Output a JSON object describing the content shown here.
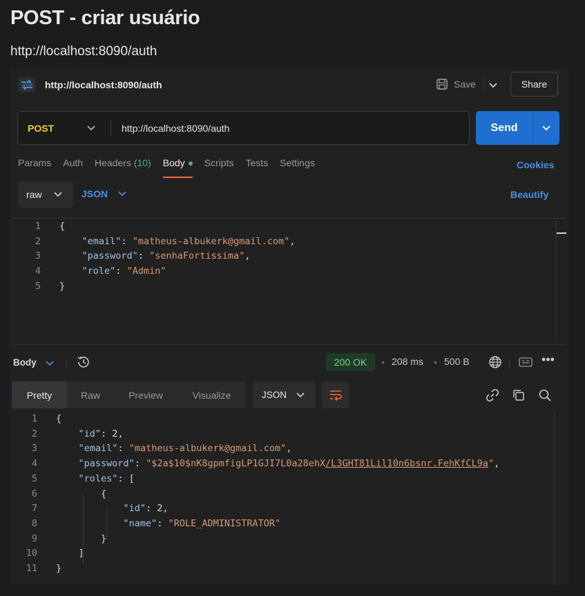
{
  "doc": {
    "title": "POST - criar usuário",
    "url": "http://localhost:8090/auth"
  },
  "request": {
    "name": "http://localhost:8090/auth",
    "badge": "HTTP",
    "save_label": "Save",
    "share_label": "Share",
    "method": "POST",
    "url": "http://localhost:8090/auth",
    "send_label": "Send",
    "tabs": [
      {
        "label": "Params"
      },
      {
        "label": "Auth"
      },
      {
        "label": "Headers",
        "count": "(10)"
      },
      {
        "label": "Body",
        "active": true
      },
      {
        "label": "Scripts"
      },
      {
        "label": "Tests"
      },
      {
        "label": "Settings"
      }
    ],
    "cookies_label": "Cookies",
    "body_mode": "raw",
    "body_format": "JSON",
    "beautify_label": "Beautify",
    "body_lines": [
      {
        "n": "1",
        "parts": [
          {
            "t": "{",
            "c": "p"
          }
        ]
      },
      {
        "n": "2",
        "parts": [
          {
            "t": "    ",
            "c": "p"
          },
          {
            "t": "\"email\"",
            "c": "k"
          },
          {
            "t": ": ",
            "c": "p"
          },
          {
            "t": "\"matheus-albukerk@gmail.com\"",
            "c": "s"
          },
          {
            "t": ",",
            "c": "p"
          }
        ]
      },
      {
        "n": "3",
        "parts": [
          {
            "t": "    ",
            "c": "p"
          },
          {
            "t": "\"password\"",
            "c": "k"
          },
          {
            "t": ": ",
            "c": "p"
          },
          {
            "t": "\"senhaFortissima\"",
            "c": "s"
          },
          {
            "t": ",",
            "c": "p"
          }
        ]
      },
      {
        "n": "4",
        "parts": [
          {
            "t": "    ",
            "c": "p"
          },
          {
            "t": "\"role\"",
            "c": "k"
          },
          {
            "t": ": ",
            "c": "p"
          },
          {
            "t": "\"Admin\"",
            "c": "s"
          }
        ]
      },
      {
        "n": "5",
        "parts": [
          {
            "t": "}",
            "c": "p"
          }
        ]
      }
    ]
  },
  "response": {
    "section_label": "Body",
    "status": "200 OK",
    "time": "208 ms",
    "size": "500 B",
    "tabs": [
      {
        "label": "Pretty",
        "active": true
      },
      {
        "label": "Raw"
      },
      {
        "label": "Preview"
      },
      {
        "label": "Visualize"
      }
    ],
    "format": "JSON",
    "body_lines": [
      {
        "n": "1",
        "parts": [
          {
            "t": "{",
            "c": "p"
          }
        ]
      },
      {
        "n": "2",
        "parts": [
          {
            "t": "    ",
            "c": "p"
          },
          {
            "t": "\"id\"",
            "c": "k"
          },
          {
            "t": ": ",
            "c": "p"
          },
          {
            "t": "2",
            "c": "n"
          },
          {
            "t": ",",
            "c": "p"
          }
        ]
      },
      {
        "n": "3",
        "parts": [
          {
            "t": "    ",
            "c": "p"
          },
          {
            "t": "\"email\"",
            "c": "k"
          },
          {
            "t": ": ",
            "c": "p"
          },
          {
            "t": "\"matheus-albukerk@gmail.com\"",
            "c": "s"
          },
          {
            "t": ",",
            "c": "p"
          }
        ]
      },
      {
        "n": "4",
        "parts": [
          {
            "t": "    ",
            "c": "p"
          },
          {
            "t": "\"password\"",
            "c": "k"
          },
          {
            "t": ": ",
            "c": "p"
          },
          {
            "t": "\"$2a$10$nK8gpmfigLP1GJI7L0a28ehX",
            "c": "s"
          },
          {
            "t": "/L3GHT81Lil10n6bsnr.FehKfCL9a",
            "c": "s u"
          },
          {
            "t": "\"",
            "c": "s"
          },
          {
            "t": ",",
            "c": "p"
          }
        ]
      },
      {
        "n": "5",
        "parts": [
          {
            "t": "    ",
            "c": "p"
          },
          {
            "t": "\"roles\"",
            "c": "k"
          },
          {
            "t": ": [",
            "c": "p"
          }
        ]
      },
      {
        "n": "6",
        "parts": [
          {
            "t": "        {",
            "c": "p"
          }
        ]
      },
      {
        "n": "7",
        "parts": [
          {
            "t": "            ",
            "c": "p"
          },
          {
            "t": "\"id\"",
            "c": "k"
          },
          {
            "t": ": ",
            "c": "p"
          },
          {
            "t": "2",
            "c": "n"
          },
          {
            "t": ",",
            "c": "p"
          }
        ]
      },
      {
        "n": "8",
        "parts": [
          {
            "t": "            ",
            "c": "p"
          },
          {
            "t": "\"name\"",
            "c": "k"
          },
          {
            "t": ": ",
            "c": "p"
          },
          {
            "t": "\"ROLE_ADMINISTRATOR\"",
            "c": "s"
          }
        ]
      },
      {
        "n": "9",
        "parts": [
          {
            "t": "        }",
            "c": "p"
          }
        ]
      },
      {
        "n": "10",
        "parts": [
          {
            "t": "    ]",
            "c": "p"
          }
        ]
      },
      {
        "n": "11",
        "parts": [
          {
            "t": "}",
            "c": "p"
          }
        ]
      }
    ]
  },
  "colors": {
    "accent_send": "#1f6fd1",
    "method_post": "#f5c542",
    "status_ok": "#6fd08a",
    "active_tab_underline": "#f26b3a",
    "link_blue": "#4a90e2"
  }
}
